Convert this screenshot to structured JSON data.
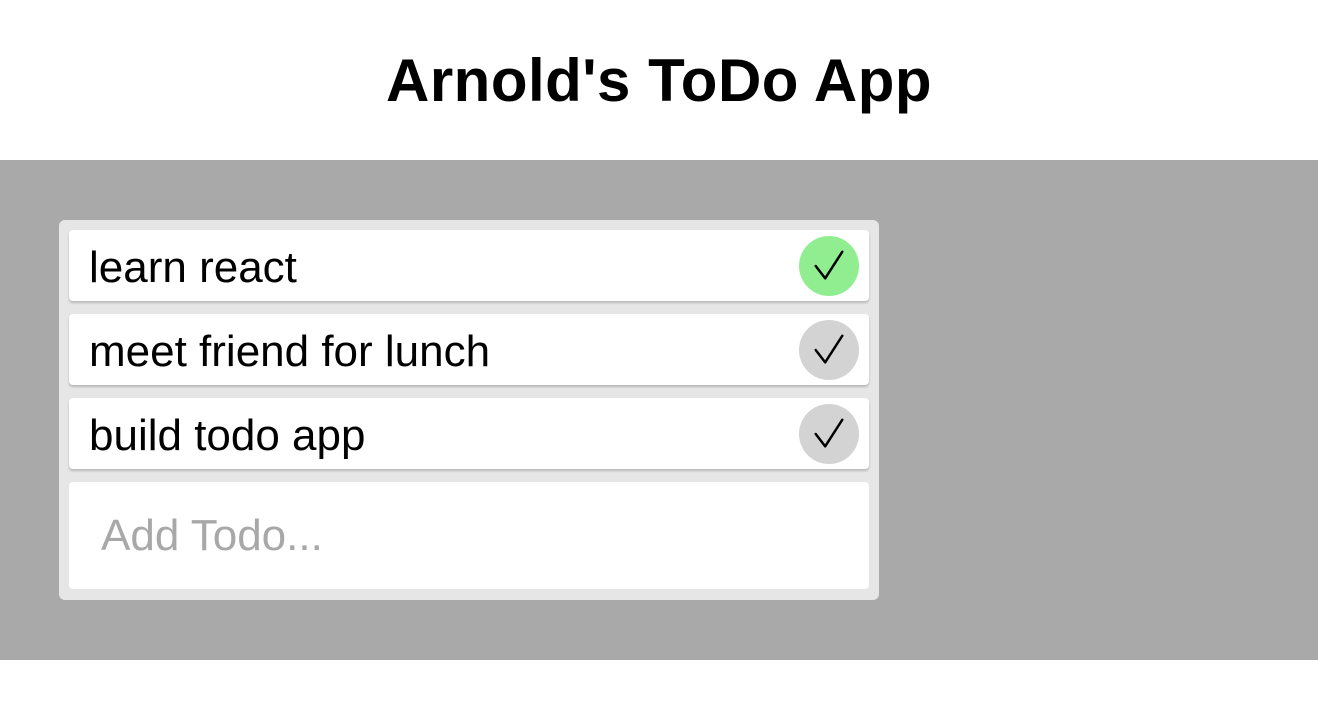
{
  "header": {
    "title": "Arnold's ToDo App"
  },
  "todos": [
    {
      "text": "learn react",
      "completed": true
    },
    {
      "text": "meet friend for lunch",
      "completed": false
    },
    {
      "text": "build todo app",
      "completed": false
    }
  ],
  "add_todo": {
    "placeholder": "Add Todo...",
    "value": ""
  },
  "colors": {
    "background": "#a9a9a9",
    "panel": "#e6e6e6",
    "completed": "#90ee90",
    "incomplete": "#d3d3d3"
  },
  "icons": {
    "check": "checkmark-icon"
  }
}
